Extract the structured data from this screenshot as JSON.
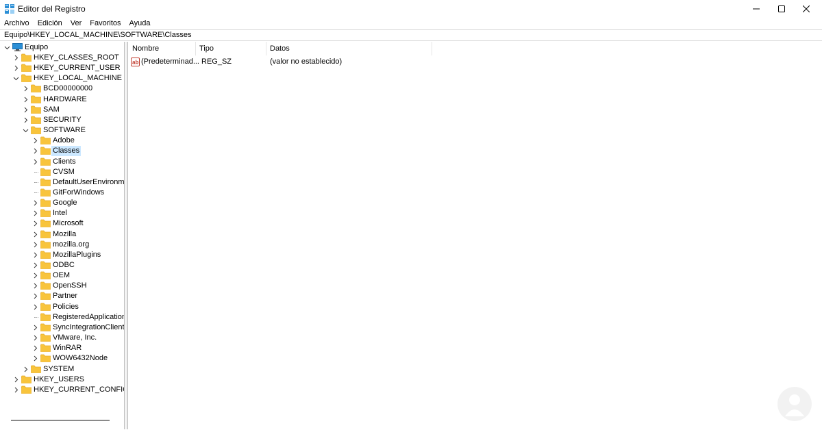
{
  "window": {
    "title": "Editor del Registro",
    "app_icon": "registry-editor-icon",
    "controls": [
      "minimize-icon",
      "maximize-icon",
      "close-icon"
    ]
  },
  "menu": {
    "items": [
      "Archivo",
      "Edición",
      "Ver",
      "Favoritos",
      "Ayuda"
    ]
  },
  "address": {
    "path": "Equipo\\HKEY_LOCAL_MACHINE\\SOFTWARE\\Classes"
  },
  "tree": {
    "root": "Equipo",
    "items": [
      {
        "label": "HKEY_CLASSES_ROOT",
        "expanded": false
      },
      {
        "label": "HKEY_CURRENT_USER",
        "expanded": false
      },
      {
        "label": "HKEY_LOCAL_MACHINE",
        "expanded": true
      },
      {
        "label": "BCD00000000",
        "expanded": false
      },
      {
        "label": "HARDWARE",
        "expanded": false
      },
      {
        "label": "SAM",
        "expanded": false
      },
      {
        "label": "SECURITY",
        "expanded": false
      },
      {
        "label": "SOFTWARE",
        "expanded": true
      },
      {
        "label": "Adobe",
        "expanded": false
      },
      {
        "label": "Classes",
        "expanded": false,
        "selected": true
      },
      {
        "label": "Clients",
        "expanded": false
      },
      {
        "label": "CVSM",
        "expanded": false
      },
      {
        "label": "DefaultUserEnvironment",
        "expanded": false
      },
      {
        "label": "GitForWindows",
        "expanded": false
      },
      {
        "label": "Google",
        "expanded": false
      },
      {
        "label": "Intel",
        "expanded": false
      },
      {
        "label": "Microsoft",
        "expanded": false
      },
      {
        "label": "Mozilla",
        "expanded": false
      },
      {
        "label": "mozilla.org",
        "expanded": false
      },
      {
        "label": "MozillaPlugins",
        "expanded": false
      },
      {
        "label": "ODBC",
        "expanded": false
      },
      {
        "label": "OEM",
        "expanded": false
      },
      {
        "label": "OpenSSH",
        "expanded": false
      },
      {
        "label": "Partner",
        "expanded": false
      },
      {
        "label": "Policies",
        "expanded": false
      },
      {
        "label": "RegisteredApplications",
        "expanded": false
      },
      {
        "label": "SyncIntegrationClients",
        "expanded": false
      },
      {
        "label": "VMware, Inc.",
        "expanded": false
      },
      {
        "label": "WinRAR",
        "expanded": false
      },
      {
        "label": "WOW6432Node",
        "expanded": false
      },
      {
        "label": "SYSTEM",
        "expanded": false
      },
      {
        "label": "HKEY_USERS",
        "expanded": false
      },
      {
        "label": "HKEY_CURRENT_CONFIG",
        "expanded": false
      }
    ]
  },
  "list": {
    "columns": [
      "Nombre",
      "Tipo",
      "Datos"
    ],
    "rows": [
      {
        "icon": "string-value-icon",
        "name": "(Predeterminad...",
        "type": "REG_SZ",
        "data": "(valor no establecido)"
      }
    ]
  },
  "colors": {
    "selection": "#cce8ff",
    "folder": "#f8c43c",
    "folder_dark": "#e5a823",
    "computer_icon": "#2b8fd6"
  },
  "watermark_icon": "watermark-logo-icon"
}
